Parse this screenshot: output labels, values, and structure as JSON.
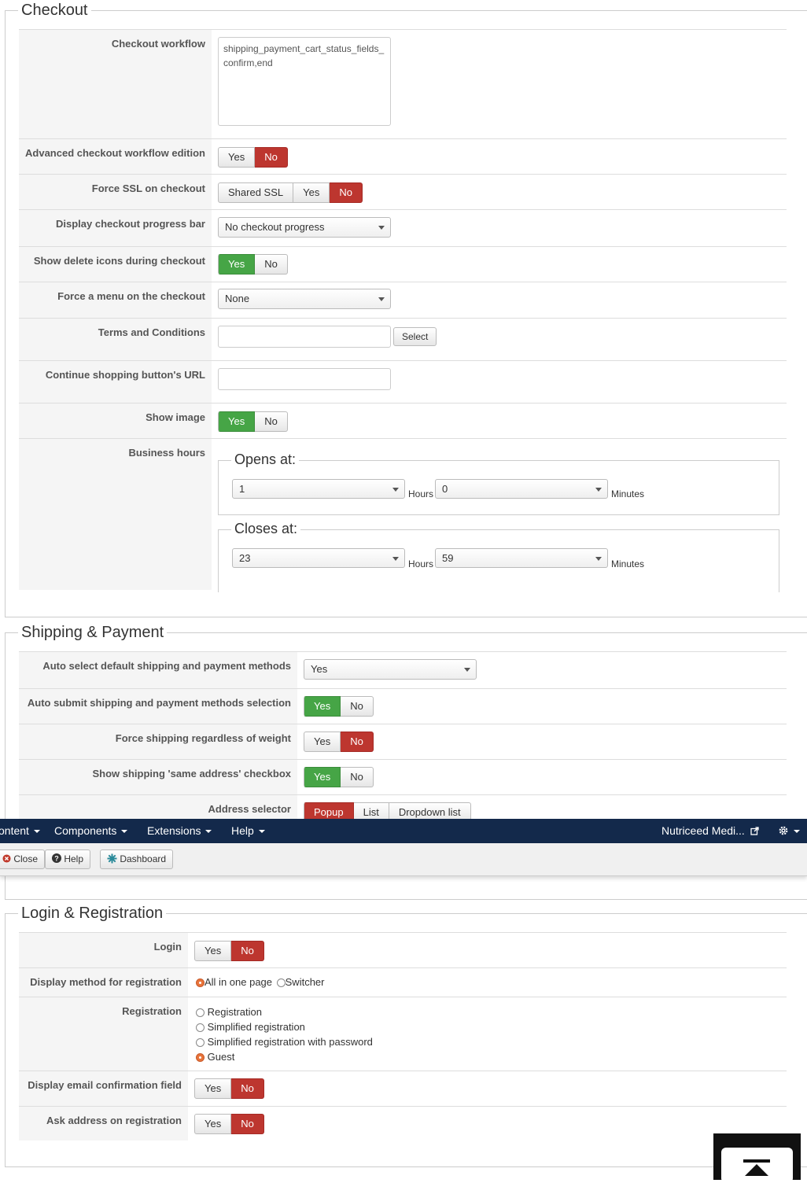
{
  "checkout": {
    "legend": "Checkout",
    "workflow_label": "Checkout workflow",
    "workflow_value": "shipping_payment_cart_status_fields_confirm,end",
    "advanced_label": "Advanced checkout workflow edition",
    "advanced_yes": "Yes",
    "advanced_no": "No",
    "ssl_label": "Force SSL on checkout",
    "ssl_shared": "Shared SSL",
    "ssl_yes": "Yes",
    "ssl_no": "No",
    "progress_label": "Display checkout progress bar",
    "progress_value": "No checkout progress",
    "delete_label": "Show delete icons during checkout",
    "delete_yes": "Yes",
    "delete_no": "No",
    "menu_label": "Force a menu on the checkout",
    "menu_value": "None",
    "terms_label": "Terms and Conditions",
    "terms_select": "Select",
    "continue_label": "Continue shopping button's URL",
    "image_label": "Show image",
    "image_yes": "Yes",
    "image_no": "No",
    "hours_label": "Business hours",
    "opens_legend": "Opens at:",
    "opens_hours": "1",
    "opens_minutes": "0",
    "closes_legend": "Closes at:",
    "closes_hours": "23",
    "closes_minutes": "59",
    "hours_unit": "Hours",
    "minutes_unit": "Minutes"
  },
  "shipping": {
    "legend": "Shipping & Payment",
    "auto_select_label": "Auto select default shipping and payment methods",
    "auto_select_value": "Yes",
    "auto_submit_label": "Auto submit shipping and payment methods selection",
    "auto_submit_yes": "Yes",
    "auto_submit_no": "No",
    "force_label": "Force shipping regardless of weight",
    "force_yes": "Yes",
    "force_no": "No",
    "same_label": "Show shipping 'same address' checkbox",
    "same_yes": "Yes",
    "same_no": "No",
    "address_label": "Address selector",
    "address_popup": "Popup",
    "address_list": "List",
    "address_dropdown": "Dropdown list"
  },
  "navbar": {
    "content": "ontent",
    "components": "Components",
    "extensions": "Extensions",
    "help": "Help",
    "site": "Nutriceed Medi..."
  },
  "toolbar": {
    "close": "Close",
    "help": "Help",
    "dashboard": "Dashboard"
  },
  "login": {
    "legend": "Login & Registration",
    "login_label": "Login",
    "login_yes": "Yes",
    "login_no": "No",
    "method_label": "Display method for registration",
    "method_all": "All in one page",
    "method_switcher": "Switcher",
    "registration_label": "Registration",
    "reg_options": [
      "Registration",
      "Simplified registration",
      "Simplified registration with password",
      "Guest"
    ],
    "email_label": "Display email confirmation field",
    "email_yes": "Yes",
    "email_no": "No",
    "address_label": "Ask address on registration",
    "address_yes": "Yes",
    "address_no": "No"
  },
  "colors": {
    "active_no": "#bd362f",
    "active_yes": "#46a546",
    "navbar": "#13294b"
  }
}
